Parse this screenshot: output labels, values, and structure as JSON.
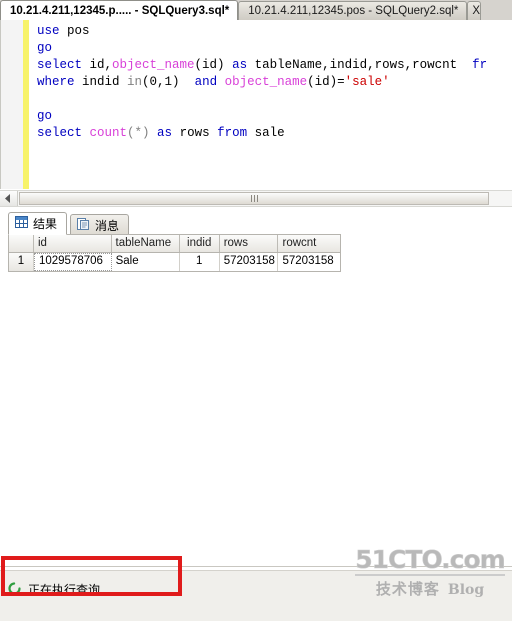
{
  "tabs": [
    {
      "label": "10.21.4.211,12345.p..... - SQLQuery3.sql*",
      "active": true
    },
    {
      "label": "10.21.4.211,12345.pos - SQLQuery2.sql*",
      "active": false
    },
    {
      "label": "X",
      "active": false
    }
  ],
  "editor": {
    "lines": [
      [
        {
          "t": "use ",
          "c": "keyword"
        },
        {
          "t": "pos",
          "c": "plain"
        }
      ],
      [
        {
          "t": "go",
          "c": "keyword"
        }
      ],
      [
        {
          "t": "select ",
          "c": "keyword"
        },
        {
          "t": "id,",
          "c": "plain"
        },
        {
          "t": "object_name",
          "c": "func"
        },
        {
          "t": "(id) ",
          "c": "plain"
        },
        {
          "t": "as ",
          "c": "keyword"
        },
        {
          "t": "tableName,indid,rows,rowcnt  ",
          "c": "plain"
        },
        {
          "t": "fr",
          "c": "keyword"
        }
      ],
      [
        {
          "t": "where ",
          "c": "keyword"
        },
        {
          "t": "indid ",
          "c": "plain"
        },
        {
          "t": "in",
          "c": "gray"
        },
        {
          "t": "(0,1)  ",
          "c": "plain"
        },
        {
          "t": "and ",
          "c": "keyword"
        },
        {
          "t": "object_name",
          "c": "func"
        },
        {
          "t": "(id)=",
          "c": "plain"
        },
        {
          "t": "'sale'",
          "c": "string"
        }
      ],
      [],
      [
        {
          "t": "go",
          "c": "keyword"
        }
      ],
      [
        {
          "t": "select ",
          "c": "keyword"
        },
        {
          "t": "count",
          "c": "func"
        },
        {
          "t": "(*) ",
          "c": "gray"
        },
        {
          "t": "as ",
          "c": "keyword"
        },
        {
          "t": "rows ",
          "c": "plain"
        },
        {
          "t": "from ",
          "c": "keyword"
        },
        {
          "t": "sale",
          "c": "plain"
        }
      ]
    ]
  },
  "result_tabs": [
    {
      "label": "结果",
      "icon": "grid-icon",
      "active": true
    },
    {
      "label": "消息",
      "icon": "message-icon",
      "active": false
    }
  ],
  "grid": {
    "columns": [
      "",
      "id",
      "tableName",
      "indid",
      "rows",
      "rowcnt"
    ],
    "rows": [
      {
        "num": "1",
        "id": "1029578706",
        "tableName": "Sale",
        "indid": "1",
        "rows": "57203158",
        "rowcnt": "57203158"
      }
    ]
  },
  "status": {
    "text": "正在执行查询...",
    "icon": "spinner-icon"
  },
  "watermark": {
    "top": "51CTO.com",
    "cn": "技术博客",
    "blog": "Blog"
  },
  "colors": {
    "keyword": "#0000c0",
    "function": "#d83fd8",
    "string": "#cc0000",
    "annotation": "#e01b1b",
    "change_bar": "#f7f36a"
  }
}
